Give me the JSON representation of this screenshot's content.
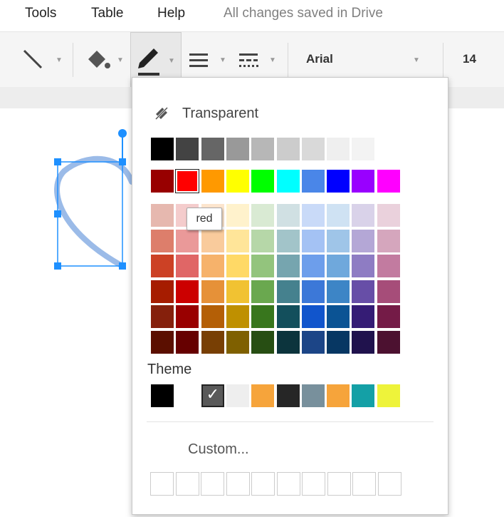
{
  "menubar": {
    "items": [
      "Tools",
      "Table",
      "Help"
    ],
    "status": "All changes saved in Drive"
  },
  "toolbar": {
    "line_icon": "line-tool-icon",
    "fill_icon": "paint-bucket-icon",
    "border_color_icon": "pencil-icon",
    "weight_icon": "line-weight-icon",
    "dash_icon": "line-dash-icon",
    "font_name": "Arial",
    "font_size": "14",
    "accent_underline": "#333333"
  },
  "palette": {
    "transparent_label": "Transparent",
    "transparent_icon": "no-fill-icon",
    "grays": [
      "#000000",
      "#434343",
      "#666666",
      "#999999",
      "#b7b7b7",
      "#cccccc",
      "#d9d9d9",
      "#efefef",
      "#f3f3f3",
      "#ffffff"
    ],
    "brights": [
      "#980000",
      "#ff0000",
      "#ff9900",
      "#ffff00",
      "#00ff00",
      "#00ffff",
      "#4a86e8",
      "#0000ff",
      "#9900ff",
      "#ff00ff"
    ],
    "selected_bright": "red",
    "tooltip": "red",
    "shades": [
      [
        "#e6b8af",
        "#f4cccc",
        "#fce5cd",
        "#fff2cc",
        "#d9ead3",
        "#d0e0e3",
        "#c9daf8",
        "#cfe2f3",
        "#d9d2e9",
        "#ead1dc"
      ],
      [
        "#dd7e6b",
        "#ea9999",
        "#f9cb9c",
        "#ffe599",
        "#b6d7a8",
        "#a2c4c9",
        "#a4c2f4",
        "#9fc5e8",
        "#b4a7d6",
        "#d5a6bd"
      ],
      [
        "#cc4125",
        "#e06666",
        "#f6b26b",
        "#ffd966",
        "#93c47d",
        "#76a5af",
        "#6d9eeb",
        "#6fa8dc",
        "#8e7cc3",
        "#c27ba0"
      ],
      [
        "#a61c00",
        "#cc0000",
        "#e69138",
        "#f1c232",
        "#6aa84f",
        "#45818e",
        "#3c78d8",
        "#3d85c6",
        "#674ea7",
        "#a64d79"
      ],
      [
        "#85200c",
        "#990000",
        "#b45f06",
        "#bf9000",
        "#38761d",
        "#134f5c",
        "#1155cc",
        "#0b5394",
        "#351c75",
        "#741b47"
      ],
      [
        "#5b0f00",
        "#660000",
        "#783f04",
        "#7f6000",
        "#274e13",
        "#0c343d",
        "#1c4587",
        "#073763",
        "#20124d",
        "#4c1130"
      ]
    ],
    "theme_label": "Theme",
    "theme": [
      "#000000",
      "#ffffff",
      "#595959",
      "#eeeeee",
      "#f6a43b",
      "#262626",
      "#78909c",
      "#f6a43b",
      "#14a0a6",
      "#eef33a"
    ],
    "theme_selected_index": 2,
    "custom_label": "Custom...",
    "custom_slot_count": 10
  },
  "shape": {
    "stroke_color": "#9bbbe8",
    "handle_color": "#1e90ff"
  }
}
